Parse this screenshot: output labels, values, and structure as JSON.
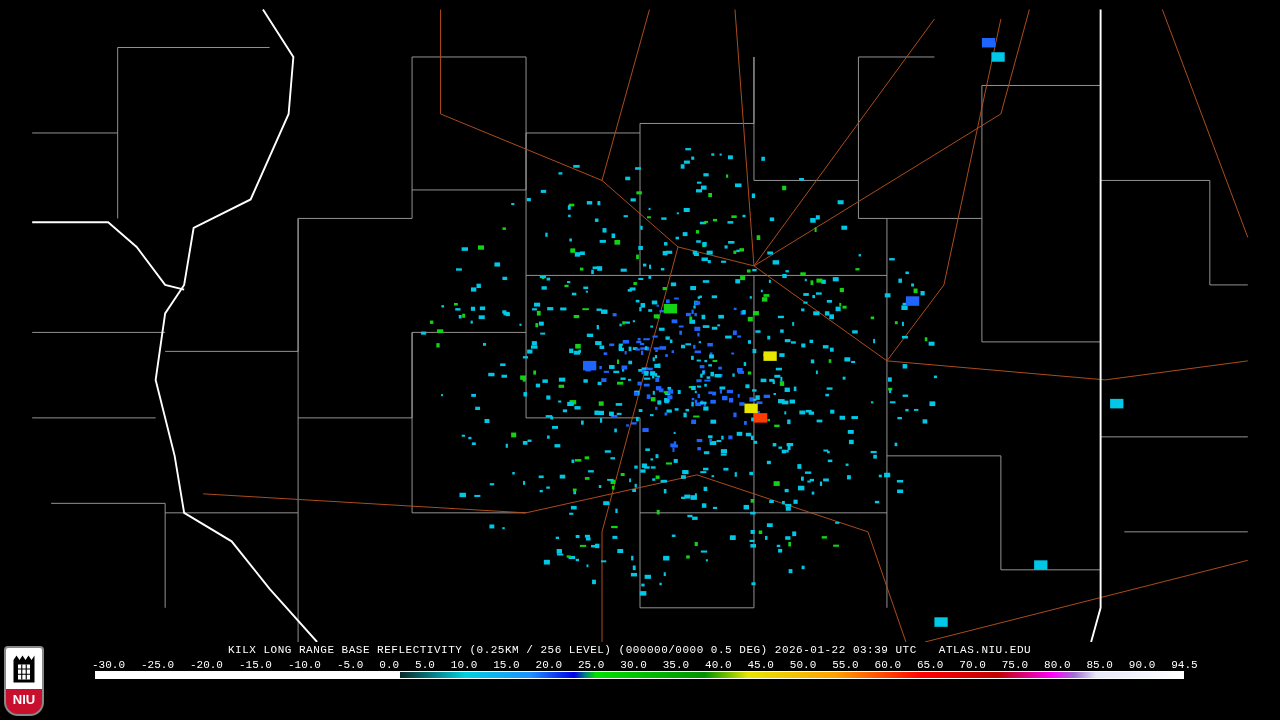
{
  "logo": {
    "text": "NIU"
  },
  "caption": {
    "product": "KILX LONG RANGE BASE REFLECTIVITY (0.25KM / 256 LEVEL) (000000/0000 0.5 DEG) 2026-01-22 03:39 UTC",
    "site": "ATLAS.NIU.EDU"
  },
  "legend": {
    "ticks": [
      "-30.0",
      "-25.0",
      "-20.0",
      "-15.0",
      "-10.0",
      "-5.0",
      "0.0",
      "5.0",
      "10.0",
      "15.0",
      "20.0",
      "25.0",
      "30.0",
      "35.0",
      "40.0",
      "45.0",
      "50.0",
      "55.0",
      "60.0",
      "65.0",
      "70.0",
      "75.0",
      "80.0",
      "85.0",
      "90.0",
      "94.5"
    ]
  }
}
